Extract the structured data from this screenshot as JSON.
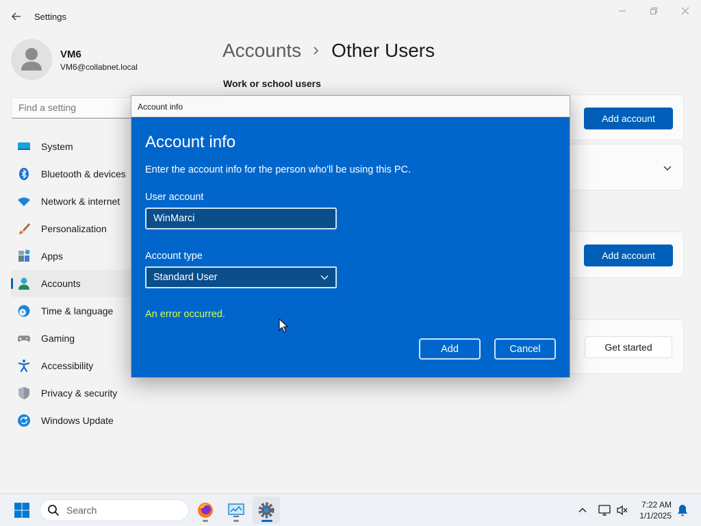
{
  "window": {
    "title": "Settings"
  },
  "user": {
    "name": "VM6",
    "email": "VM6@collabnet.local"
  },
  "search": {
    "placeholder": "Find a setting"
  },
  "nav": {
    "items": [
      {
        "label": "System",
        "icon": "system-icon"
      },
      {
        "label": "Bluetooth & devices",
        "icon": "bluetooth-icon"
      },
      {
        "label": "Network & internet",
        "icon": "wifi-icon"
      },
      {
        "label": "Personalization",
        "icon": "brush-icon"
      },
      {
        "label": "Apps",
        "icon": "apps-icon"
      },
      {
        "label": "Accounts",
        "icon": "accounts-icon",
        "active": true
      },
      {
        "label": "Time & language",
        "icon": "clock-globe-icon"
      },
      {
        "label": "Gaming",
        "icon": "gamepad-icon"
      },
      {
        "label": "Accessibility",
        "icon": "accessibility-icon"
      },
      {
        "label": "Privacy & security",
        "icon": "shield-icon"
      },
      {
        "label": "Windows Update",
        "icon": "update-icon"
      }
    ]
  },
  "main": {
    "breadcrumb": {
      "parent": "Accounts",
      "current": "Other Users"
    },
    "section_title": "Work or school users",
    "buttons": {
      "add_account_1": "Add account",
      "add_account_2": "Add account",
      "get_started": "Get started"
    }
  },
  "dialog": {
    "window_title": "Account info",
    "heading": "Account info",
    "description": "Enter the account info for the person who'll be using this PC.",
    "user_account_label": "User account",
    "user_account_value": "WinMarci",
    "account_type_label": "Account type",
    "account_type_value": "Standard User",
    "error": "An error occurred.",
    "add_label": "Add",
    "cancel_label": "Cancel"
  },
  "taskbar": {
    "search_label": "Search",
    "time": "7:22 AM",
    "date": "1/1/2025"
  },
  "colors": {
    "accent": "#005fb8",
    "dialog_bg": "#0066cc",
    "error_text": "#d8ff3a"
  }
}
